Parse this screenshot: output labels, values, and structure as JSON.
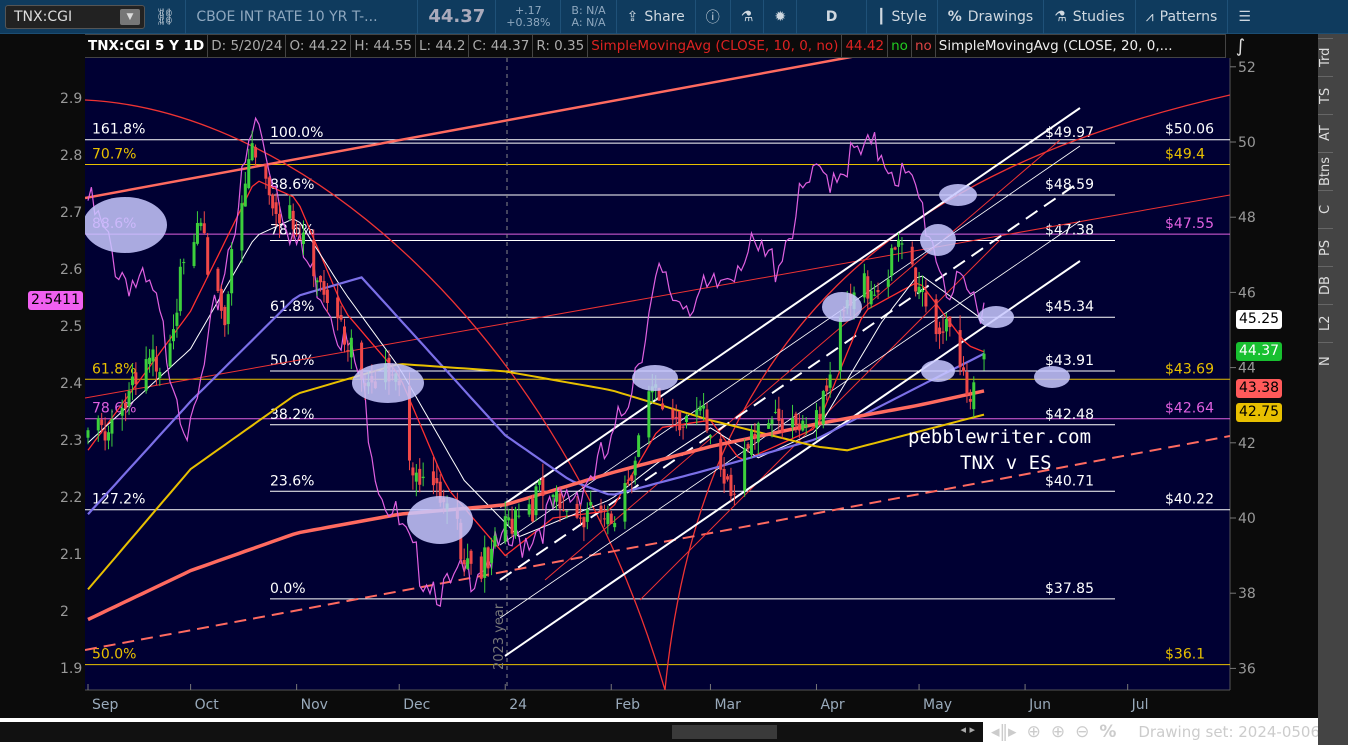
{
  "toolbar": {
    "symbol": "TNX:CGI",
    "description": "CBOE INT RATE 10 YR T-...",
    "last": "44.37",
    "change": "+.17",
    "change_pct": "+0.38%",
    "bid": "B: N/A",
    "ask": "A: N/A",
    "share": "Share",
    "period": "D",
    "style": "Style",
    "drawings": "Drawings",
    "studies": "Studies",
    "patterns": "Patterns"
  },
  "header": {
    "title": "TNX:CGI 5 Y 1D",
    "date": "D: 5/20/24",
    "open": "O: 44.22",
    "high": "H: 44.55",
    "low": "L: 44.2",
    "close": "C: 44.37",
    "range": "R: 0.35",
    "study1": "SimpleMovingAvg (CLOSE, 10, 0, no)",
    "study1_value": "44.42",
    "study1_flag1": "no",
    "study1_flag2": "no",
    "study2": "SimpleMovingAvg (CLOSE, 20, 0,..."
  },
  "right_tabs": [
    "Trd",
    "TS",
    "AT",
    "Btns",
    "C",
    "PS",
    "DB",
    "L2",
    "N"
  ],
  "bottom": {
    "drawing_set": "Drawing set: 2024-0506"
  },
  "annotations": {
    "watermark": "pebblewriter.com",
    "subtitle": "TNX v ES",
    "year_marker": "2023 year"
  },
  "price_tags": {
    "left": "2.5411",
    "t45": "45.25",
    "t44": "44.37",
    "t43": "43.38",
    "t42": "42.75"
  },
  "colors": {
    "bg": "#000033",
    "up": "#3ccf3c",
    "down": "#f04848",
    "sma10": "#ff3030",
    "sma20": "#ffffff",
    "sma50": "#7b6fe8",
    "sma100": "#e8c000",
    "sma200": "#ff6a60",
    "es_ratio": "#e060e0"
  },
  "chart_data": {
    "type": "candlestick",
    "title": "TNX:CGI 5 Y 1D",
    "right_axis": {
      "ticks": [
        "52",
        "50",
        "48",
        "46",
        "44",
        "42",
        "40",
        "38",
        "36"
      ],
      "range": [
        35.3,
        52.4
      ]
    },
    "left_axis": {
      "ticks": [
        "2.9",
        "2.8",
        "2.7",
        "2.6",
        "2.5",
        "2.4",
        "2.3",
        "2.2",
        "2.1",
        "2",
        "1.9"
      ],
      "range": [
        1.86,
        2.96
      ]
    },
    "x_ticks": [
      {
        "label": "Sep",
        "date": "2023-09-01"
      },
      {
        "label": "Oct",
        "date": "2023-10-01"
      },
      {
        "label": "Nov",
        "date": "2023-11-01"
      },
      {
        "label": "Dec",
        "date": "2023-12-01"
      },
      {
        "label": "24",
        "date": "2024-01-01"
      },
      {
        "label": "Feb",
        "date": "2024-02-01"
      },
      {
        "label": "Mar",
        "date": "2024-03-01"
      },
      {
        "label": "Apr",
        "date": "2024-04-01"
      },
      {
        "label": "May",
        "date": "2024-05-01"
      },
      {
        "label": "Jun",
        "date": "2024-06-01"
      },
      {
        "label": "Jul",
        "date": "2024-07-01"
      }
    ],
    "close_keypoints": [
      [
        "2023-09-01",
        42.0
      ],
      [
        "2023-09-15",
        43.3
      ],
      [
        "2023-09-22",
        44.4
      ],
      [
        "2023-10-03",
        47.5
      ],
      [
        "2023-10-11",
        45.6
      ],
      [
        "2023-10-19",
        49.9
      ],
      [
        "2023-10-26",
        48.5
      ],
      [
        "2023-11-01",
        47.5
      ],
      [
        "2023-11-10",
        46.3
      ],
      [
        "2023-11-15",
        44.5
      ],
      [
        "2023-11-30",
        43.4
      ],
      [
        "2023-12-05",
        41.7
      ],
      [
        "2023-12-13",
        40.2
      ],
      [
        "2023-12-27",
        38.5
      ],
      [
        "2024-01-05",
        40.5
      ],
      [
        "2024-01-15",
        40.5
      ],
      [
        "2024-01-31",
        39.6
      ],
      [
        "2024-02-13",
        43.2
      ],
      [
        "2024-02-28",
        42.5
      ],
      [
        "2024-03-08",
        40.9
      ],
      [
        "2024-03-19",
        43.0
      ],
      [
        "2024-03-29",
        42.0
      ],
      [
        "2024-04-10",
        45.5
      ],
      [
        "2024-04-25",
        47.0
      ],
      [
        "2024-05-01",
        46.3
      ],
      [
        "2024-05-15",
        43.5
      ],
      [
        "2024-05-20",
        44.37
      ]
    ],
    "series": [
      {
        "name": "SMA10",
        "axis": "right",
        "points": [
          [
            "2023-09-01",
            41.8
          ],
          [
            "2023-10-01",
            45.5
          ],
          [
            "2023-10-20",
            49.0
          ],
          [
            "2023-11-01",
            48.5
          ],
          [
            "2023-11-15",
            45.5
          ],
          [
            "2023-12-01",
            43.8
          ],
          [
            "2023-12-15",
            40.8
          ],
          [
            "2024-01-01",
            39.0
          ],
          [
            "2024-01-15",
            40.0
          ],
          [
            "2024-02-01",
            40.2
          ],
          [
            "2024-02-15",
            42.4
          ],
          [
            "2024-03-01",
            42.6
          ],
          [
            "2024-03-10",
            41.5
          ],
          [
            "2024-04-01",
            42.4
          ],
          [
            "2024-04-15",
            45.5
          ],
          [
            "2024-05-01",
            46.3
          ],
          [
            "2024-05-15",
            44.6
          ],
          [
            "2024-05-20",
            44.42
          ]
        ]
      },
      {
        "name": "SMA20",
        "axis": "right",
        "points": [
          [
            "2023-09-01",
            42.0
          ],
          [
            "2023-10-01",
            44.5
          ],
          [
            "2023-10-20",
            47.5
          ],
          [
            "2023-11-01",
            48.0
          ],
          [
            "2023-11-15",
            46.0
          ],
          [
            "2023-12-01",
            44.0
          ],
          [
            "2023-12-20",
            41.0
          ],
          [
            "2024-01-05",
            39.5
          ],
          [
            "2024-02-01",
            40.5
          ],
          [
            "2024-02-15",
            41.5
          ],
          [
            "2024-03-01",
            42.4
          ],
          [
            "2024-03-15",
            41.6
          ],
          [
            "2024-04-01",
            42.3
          ],
          [
            "2024-04-20",
            45.2
          ],
          [
            "2024-05-01",
            46.5
          ],
          [
            "2024-05-20",
            45.25
          ]
        ]
      },
      {
        "name": "SMA50",
        "axis": "right",
        "points": [
          [
            "2023-09-01",
            40.1
          ],
          [
            "2023-10-01",
            43.1
          ],
          [
            "2023-11-01",
            45.9
          ],
          [
            "2023-11-20",
            46.4
          ],
          [
            "2023-12-01",
            45.3
          ],
          [
            "2024-01-01",
            42.2
          ],
          [
            "2024-01-20",
            41.0
          ],
          [
            "2024-02-01",
            40.6
          ],
          [
            "2024-03-01",
            41.3
          ],
          [
            "2024-04-01",
            42.1
          ],
          [
            "2024-05-01",
            43.5
          ],
          [
            "2024-05-20",
            44.37
          ]
        ]
      },
      {
        "name": "SMA100",
        "axis": "right",
        "points": [
          [
            "2023-09-01",
            38.1
          ],
          [
            "2023-10-01",
            41.3
          ],
          [
            "2023-11-01",
            43.3
          ],
          [
            "2023-12-01",
            44.1
          ],
          [
            "2024-01-01",
            43.9
          ],
          [
            "2024-02-01",
            43.4
          ],
          [
            "2024-03-01",
            42.6
          ],
          [
            "2024-04-01",
            41.9
          ],
          [
            "2024-04-10",
            41.8
          ],
          [
            "2024-05-01",
            42.3
          ],
          [
            "2024-05-20",
            42.75
          ]
        ]
      },
      {
        "name": "SMA200",
        "axis": "right",
        "points": [
          [
            "2023-09-01",
            37.3
          ],
          [
            "2023-10-01",
            38.6
          ],
          [
            "2023-11-01",
            39.6
          ],
          [
            "2023-12-01",
            40.1
          ],
          [
            "2024-01-01",
            40.35
          ],
          [
            "2024-02-01",
            41.2
          ],
          [
            "2024-03-01",
            41.9
          ],
          [
            "2024-04-01",
            42.5
          ],
          [
            "2024-05-01",
            43.0
          ],
          [
            "2024-05-20",
            43.38
          ]
        ]
      },
      {
        "name": "ES ratio",
        "axis": "left",
        "points": [
          [
            "2023-09-01",
            2.72
          ],
          [
            "2023-09-10",
            2.6
          ],
          [
            "2023-09-20",
            2.55
          ],
          [
            "2023-10-01",
            2.3
          ],
          [
            "2023-10-10",
            2.58
          ],
          [
            "2023-10-20",
            2.86
          ],
          [
            "2023-11-01",
            2.64
          ],
          [
            "2023-11-10",
            2.55
          ],
          [
            "2023-11-20",
            2.4
          ],
          [
            "2023-11-25",
            2.23
          ],
          [
            "2023-12-05",
            2.09
          ],
          [
            "2023-12-15",
            2.03
          ],
          [
            "2023-12-25",
            2.09
          ],
          [
            "2024-01-05",
            2.12
          ],
          [
            "2024-01-20",
            2.2
          ],
          [
            "2024-02-01",
            2.28
          ],
          [
            "2024-02-15",
            2.58
          ],
          [
            "2024-02-20",
            2.55
          ],
          [
            "2024-03-01",
            2.55
          ],
          [
            "2024-03-10",
            2.63
          ],
          [
            "2024-03-20",
            2.61
          ],
          [
            "2024-03-29",
            2.74
          ],
          [
            "2024-04-10",
            2.79
          ],
          [
            "2024-04-20",
            2.81
          ],
          [
            "2024-05-01",
            2.72
          ],
          [
            "2024-05-10",
            2.56
          ],
          [
            "2024-05-20",
            2.5411
          ]
        ]
      }
    ],
    "fib_levels": [
      {
        "label": "100.0%",
        "price": "$49.97",
        "value": 49.97
      },
      {
        "label": "88.6%",
        "price": "$48.59",
        "value": 48.59
      },
      {
        "label": "78.6%",
        "price": "$47.38",
        "value": 47.38
      },
      {
        "label": "61.8%",
        "price": "$45.34",
        "value": 45.34
      },
      {
        "label": "50.0%",
        "price": "$43.91",
        "value": 43.91
      },
      {
        "label": "38.2%",
        "price": "$42.48",
        "value": 42.48
      },
      {
        "label": "23.6%",
        "price": "$40.71",
        "value": 40.71
      },
      {
        "label": "0.0%",
        "price": "$37.85",
        "value": 37.85
      }
    ],
    "ext_levels": [
      {
        "label": "161.8%",
        "price": "$50.06",
        "value": 50.06,
        "color": "#ffffff"
      },
      {
        "label": "70.7%",
        "price": "$49.4",
        "value": 49.4,
        "color": "#e8c000"
      },
      {
        "label": "88.6%",
        "price": "$47.55",
        "value": 47.55,
        "color": "#e060e0"
      },
      {
        "label": "61.8%",
        "price": "$43.69",
        "value": 43.69,
        "color": "#e8c000"
      },
      {
        "label": "78.6%",
        "price": "$42.64",
        "value": 42.64,
        "color": "#e060e0"
      },
      {
        "label": "127.2%",
        "price": "$40.22",
        "value": 40.22,
        "color": "#ffffff"
      },
      {
        "label": "50.0%",
        "price": "$36.1",
        "value": 36.1,
        "color": "#e8c000"
      }
    ]
  }
}
